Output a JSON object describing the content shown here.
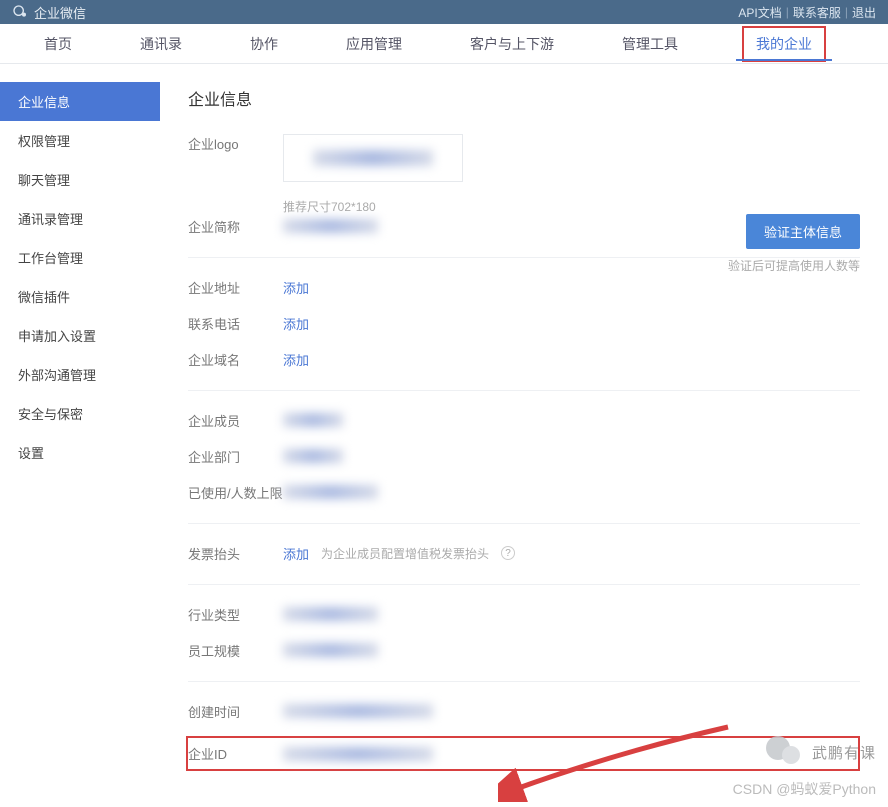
{
  "header": {
    "product_name": "企业微信",
    "links": {
      "api_docs": "API文档",
      "support": "联系客服",
      "logout": "退出"
    }
  },
  "nav": {
    "items": [
      {
        "label": "首页"
      },
      {
        "label": "通讯录"
      },
      {
        "label": "协作"
      },
      {
        "label": "应用管理"
      },
      {
        "label": "客户与上下游"
      },
      {
        "label": "管理工具"
      },
      {
        "label": "我的企业",
        "active": true
      }
    ]
  },
  "sidebar": {
    "items": [
      {
        "label": "企业信息",
        "active": true
      },
      {
        "label": "权限管理"
      },
      {
        "label": "聊天管理"
      },
      {
        "label": "通讯录管理"
      },
      {
        "label": "工作台管理"
      },
      {
        "label": "微信插件"
      },
      {
        "label": "申请加入设置"
      },
      {
        "label": "外部沟通管理"
      },
      {
        "label": "安全与保密"
      },
      {
        "label": "设置"
      }
    ]
  },
  "main": {
    "title": "企业信息",
    "logo_label": "企业logo",
    "logo_hint": "推荐尺寸702*180",
    "verify_btn": "验证主体信息",
    "verify_hint": "验证后可提高使用人数等",
    "fields": {
      "short_name": "企业简称",
      "address": "企业地址",
      "phone": "联系电话",
      "domain": "企业域名",
      "members": "企业成员",
      "depts": "企业部门",
      "quota": "已使用/人数上限",
      "invoice": "发票抬头",
      "invoice_hint": "为企业成员配置增值税发票抬头",
      "industry": "行业类型",
      "scale": "员工规模",
      "created": "创建时间",
      "corpid": "企业ID"
    },
    "add_link": "添加",
    "help_icon_title": "帮助"
  },
  "watermark": {
    "bubble": "武鹏有课",
    "csdn": "CSDN @蚂蚁爱Python"
  }
}
